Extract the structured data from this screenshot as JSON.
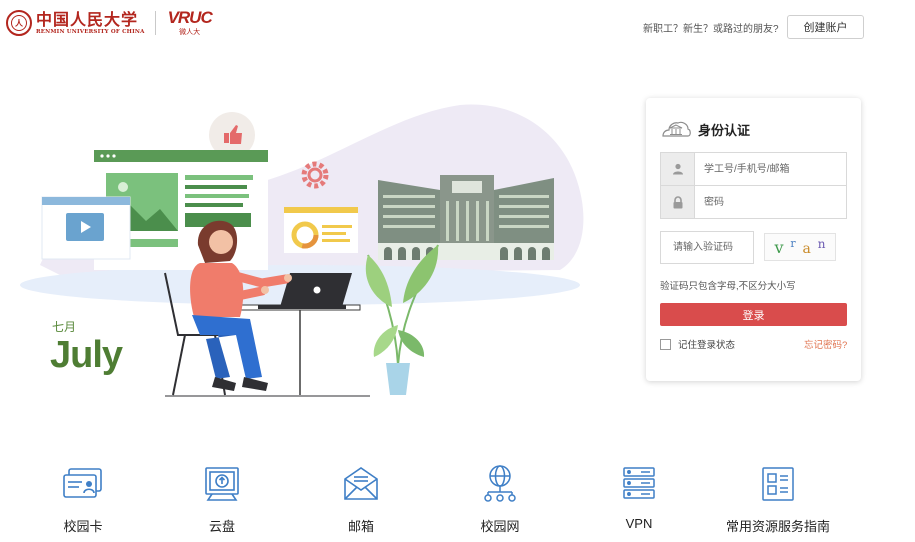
{
  "header": {
    "logo": {
      "university_cn": "中国人民大学",
      "university_en": "RENMIN UNIVERSITY OF CHINA",
      "vruc_mark": "VRUC",
      "vruc_sub": "微人大"
    },
    "prompt": "新职工？新生？或路过的朋友?",
    "create_account": "创建账户"
  },
  "hero": {
    "month_cn": "七月",
    "month_en": "July"
  },
  "login": {
    "title": "身份认证",
    "username_placeholder": "学工号/手机号/邮箱",
    "password_placeholder": "密码",
    "captcha_placeholder": "请输入验证码",
    "captcha_chars": [
      "v",
      "r",
      "a",
      "n"
    ],
    "captcha_hint": "验证码只包含字母,不区分大小写",
    "submit": "登录",
    "remember": "记住登录状态",
    "forgot": "忘记密码?"
  },
  "services": [
    {
      "label": "校园卡",
      "icon": "campus-card-icon"
    },
    {
      "label": "云盘",
      "icon": "cloud-drive-icon"
    },
    {
      "label": "邮箱",
      "icon": "mail-icon"
    },
    {
      "label": "校园网",
      "icon": "campus-network-icon"
    },
    {
      "label": "VPN",
      "icon": "vpn-server-icon"
    },
    {
      "label": "常用资源服务指南",
      "icon": "service-guide-icon"
    }
  ],
  "colors": {
    "brand_red": "#b3261e",
    "login_button": "#d94c4c",
    "forgot_link": "#e0734f",
    "icon_blue": "#3f7fc6",
    "month_green": "#4e7d33"
  }
}
